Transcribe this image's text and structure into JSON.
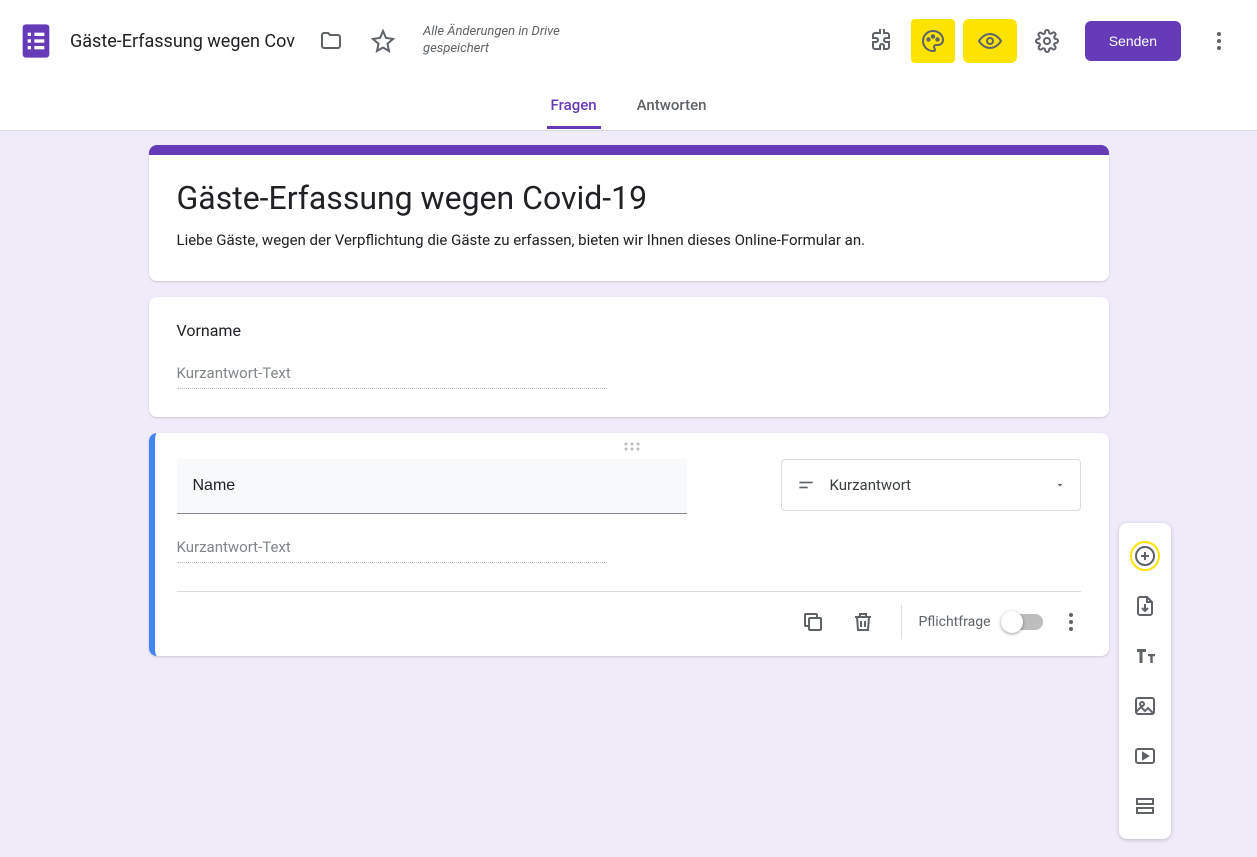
{
  "header": {
    "doc_title": "Gäste-Erfassung wegen Cov",
    "save_status": "Alle Änderungen in Drive gespeichert",
    "send_label": "Senden"
  },
  "tabs": {
    "questions": "Fragen",
    "responses": "Antworten"
  },
  "form": {
    "title": "Gäste-Erfassung wegen Covid-19",
    "description": "Liebe Gäste, wegen der Verpflichtung die Gäste zu erfassen, bieten wir Ihnen dieses Online-Formular an."
  },
  "q1": {
    "label": "Vorname",
    "placeholder": "Kurzantwort-Text"
  },
  "q2": {
    "title": "Name",
    "type_label": "Kurzantwort",
    "placeholder": "Kurzantwort-Text",
    "required_label": "Pflichtfrage"
  }
}
